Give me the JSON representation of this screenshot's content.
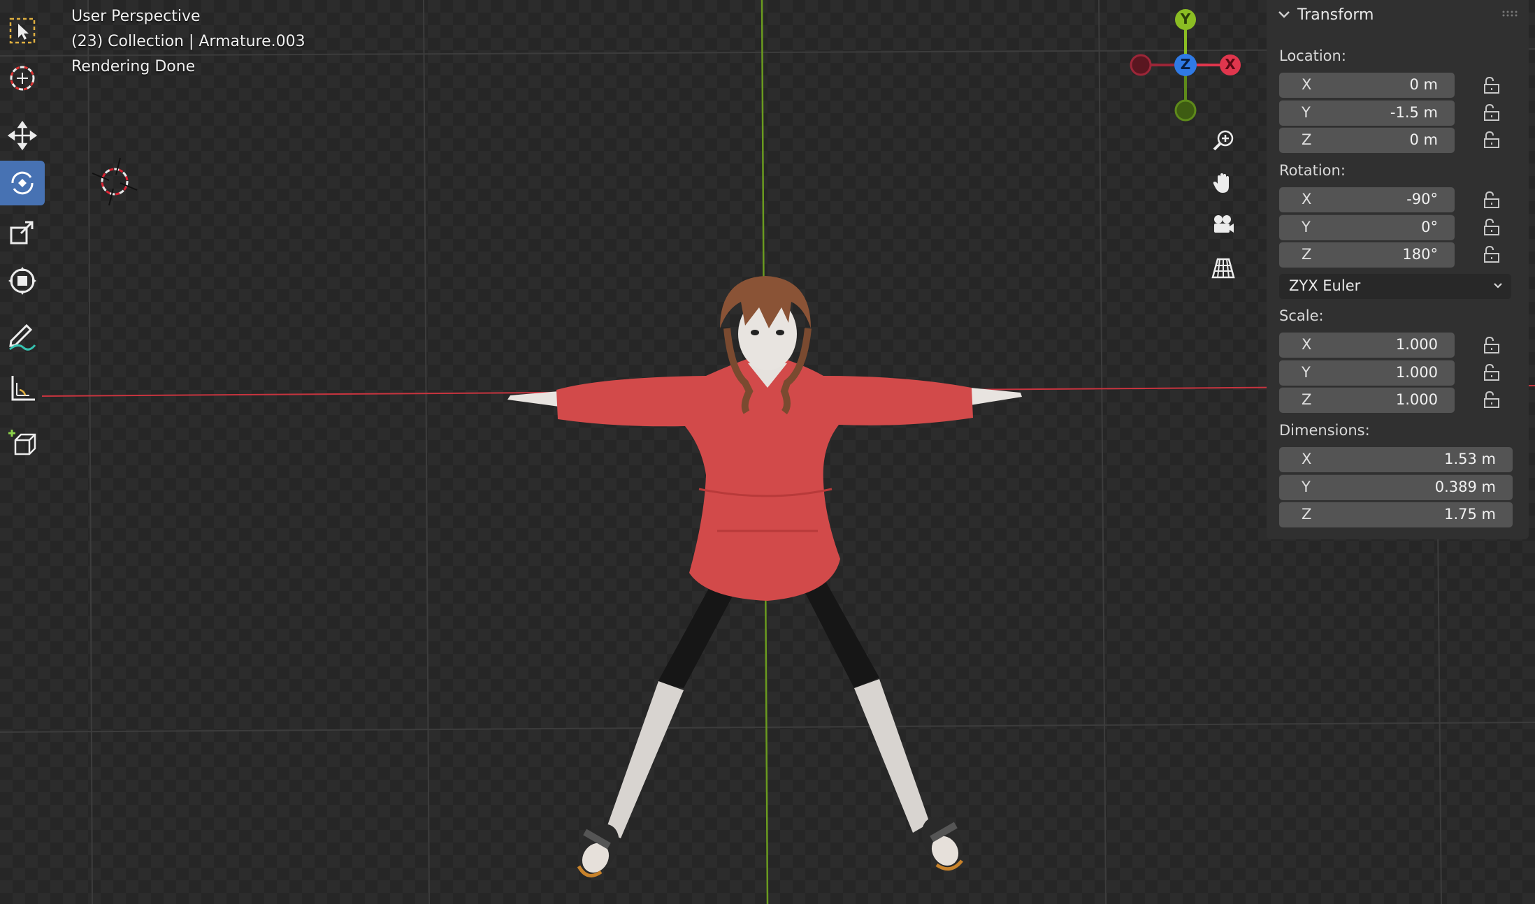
{
  "viewport": {
    "hud": [
      "User Perspective",
      "(23) Collection | Armature.003",
      "Rendering Done"
    ]
  },
  "toolbar": {
    "tools": [
      {
        "name": "select-box-tool",
        "icon": "cursor-select-icon",
        "active": false
      },
      {
        "name": "cursor-tool",
        "icon": "3d-cursor-icon",
        "active": false
      },
      {
        "name": "move-tool",
        "icon": "move-arrows-icon",
        "active": false
      },
      {
        "name": "rotate-tool",
        "icon": "rotate-icon",
        "active": true
      },
      {
        "name": "scale-tool",
        "icon": "scale-icon",
        "active": false
      },
      {
        "name": "transform-tool",
        "icon": "transform-icon",
        "active": false
      },
      {
        "name": "annotate-tool",
        "icon": "pencil-icon",
        "active": false
      },
      {
        "name": "measure-tool",
        "icon": "ruler-icon",
        "active": false
      },
      {
        "name": "add-cube-tool",
        "icon": "add-cube-icon",
        "active": false
      }
    ]
  },
  "gizmo": {
    "axes": {
      "y": "Y",
      "z": "Z",
      "x": "X"
    },
    "colors": {
      "x": "#e0364d",
      "y": "#8bbd23",
      "z": "#2f7ae6",
      "neg_x": "#9c2638",
      "neg_y": "#5e8a1a"
    }
  },
  "nav_buttons": [
    "zoom-icon",
    "hand-pan-icon",
    "camera-icon",
    "grid-perspective-icon"
  ],
  "panel": {
    "title": "Transform",
    "location_label": "Location:",
    "location": [
      {
        "axis": "X",
        "value": "0 m"
      },
      {
        "axis": "Y",
        "value": "-1.5 m"
      },
      {
        "axis": "Z",
        "value": "0 m"
      }
    ],
    "rotation_label": "Rotation:",
    "rotation": [
      {
        "axis": "X",
        "value": "-90°"
      },
      {
        "axis": "Y",
        "value": "0°"
      },
      {
        "axis": "Z",
        "value": "180°"
      }
    ],
    "rotation_mode": "ZYX Euler",
    "scale_label": "Scale:",
    "scale": [
      {
        "axis": "X",
        "value": "1.000"
      },
      {
        "axis": "Y",
        "value": "1.000"
      },
      {
        "axis": "Z",
        "value": "1.000"
      }
    ],
    "dimensions_label": "Dimensions:",
    "dimensions": [
      {
        "axis": "X",
        "value": "1.53 m"
      },
      {
        "axis": "Y",
        "value": "0.389 m"
      },
      {
        "axis": "Z",
        "value": "1.75 m"
      }
    ]
  },
  "colors": {
    "accent": "#4772b3",
    "x_axis_line": "#c8343f",
    "y_axis_line": "#6a9a1f",
    "hoodie": "#d24a4a"
  }
}
